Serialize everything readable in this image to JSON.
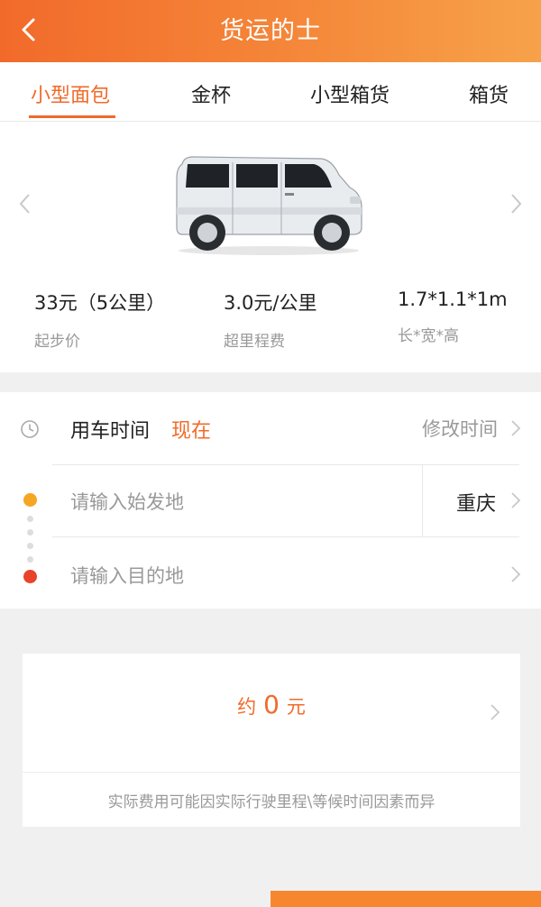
{
  "header": {
    "title": "货运的士",
    "back_icon": "chevron-left-icon"
  },
  "tabs": [
    {
      "label": "小型面包",
      "active": true
    },
    {
      "label": "金杯",
      "active": false
    },
    {
      "label": "小型箱货",
      "active": false
    },
    {
      "label": "箱货",
      "active": false
    }
  ],
  "vehicle": {
    "image": "white-minivan",
    "specs": [
      {
        "value": "33元（5公里）",
        "label": "起步价"
      },
      {
        "value": "3.0元/公里",
        "label": "超里程费"
      },
      {
        "value": "1.7*1.1*1m",
        "label": "长*宽*高"
      }
    ]
  },
  "booking": {
    "time_label": "用车时间",
    "time_value": "现在",
    "modify_time": "修改时间",
    "origin_placeholder": "请输入始发地",
    "city": "重庆",
    "destination_placeholder": "请输入目的地"
  },
  "estimate": {
    "prefix": "约",
    "amount": "0",
    "unit": "元",
    "note": "实际费用可能因实际行驶里程\\等候时间因素而异"
  },
  "colors": {
    "accent": "#f26a2a",
    "origin_dot": "#f5a623",
    "destination_dot": "#e8432b"
  }
}
